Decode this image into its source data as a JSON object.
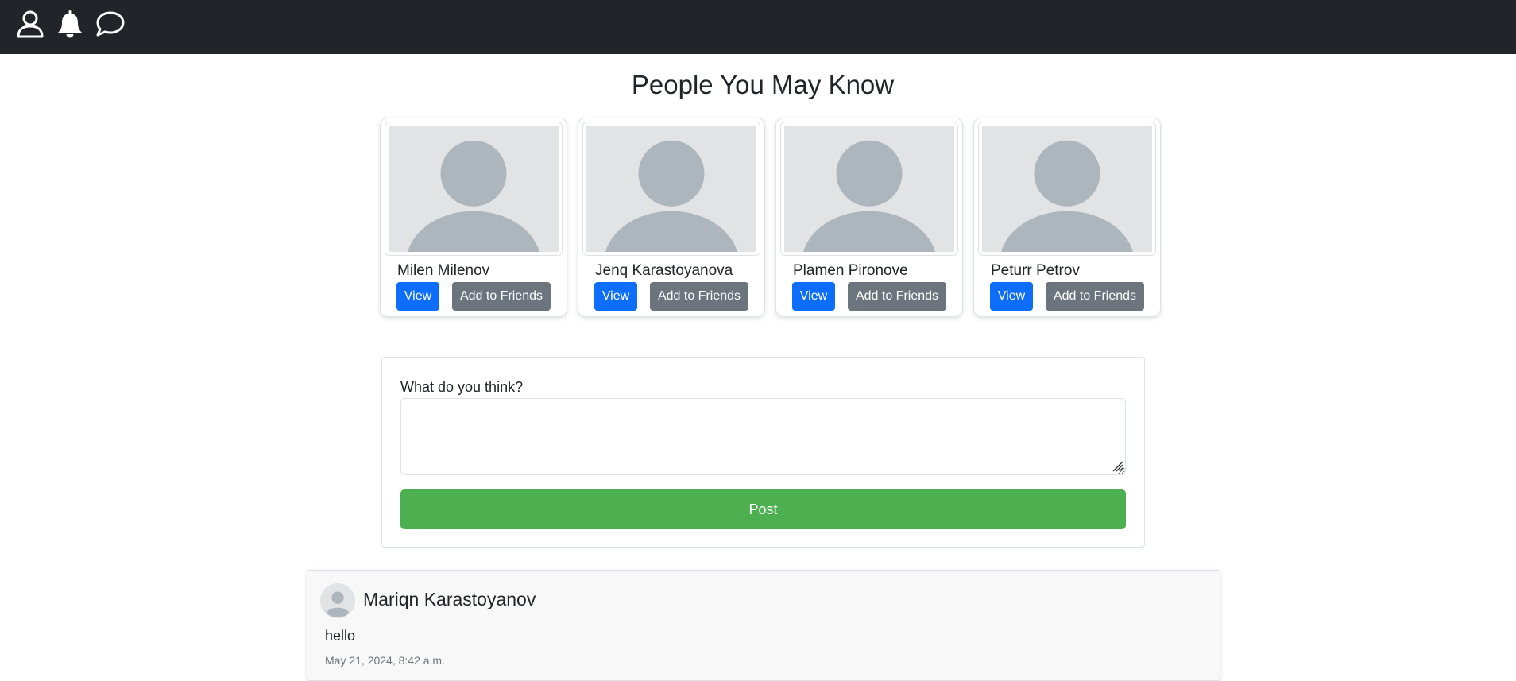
{
  "navbar": {
    "icons": [
      "user-icon",
      "bell-icon",
      "chat-icon"
    ]
  },
  "page_title": "People You May Know",
  "suggestions": [
    {
      "name": "Milen Milenov",
      "view_label": "View",
      "add_label": "Add to Friends"
    },
    {
      "name": "Jenq Karastoyanova",
      "view_label": "View",
      "add_label": "Add to Friends"
    },
    {
      "name": "Plamen Pironove",
      "view_label": "View",
      "add_label": "Add to Friends"
    },
    {
      "name": "Peturr Petrov",
      "view_label": "View",
      "add_label": "Add to Friends"
    }
  ],
  "post_form": {
    "label": "What do you think?",
    "textarea_value": "",
    "button_label": "Post"
  },
  "feed": [
    {
      "author": "Mariqn Karastoyanov",
      "content": "hello",
      "date": "May 21, 2024, 8:42 a.m."
    }
  ],
  "colors": {
    "navbar": "#212529",
    "primary": "#0d6efd",
    "secondary": "#6c757d",
    "post_button": "#4caf50",
    "avatar_bg": "#e2e3e5",
    "avatar_fg": "#adb5bd"
  }
}
